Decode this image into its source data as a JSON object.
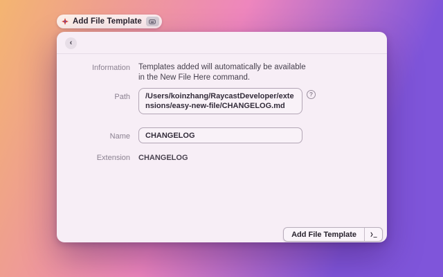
{
  "colors": {
    "bg-start": "#f4b571",
    "bg-mid": "#ee86bd",
    "bg-end": "#7f55da",
    "window-bg": "#f7eef6"
  },
  "toolbar": {
    "title": "Add File Template",
    "extension_icon": "extension-icon",
    "badge_icon": "keycap-icon"
  },
  "window": {
    "back_icon": "‹",
    "form": {
      "information_label": "Information",
      "information_text": "Templates added will automatically be available in the New File Here command.",
      "path_label": "Path",
      "path_value": "/Users/koinzhang/RaycastDeveloper/extensions/easy-new-file/CHANGELOG.md",
      "help_icon": "?",
      "name_label": "Name",
      "name_value": "CHANGELOG",
      "extension_label": "Extension",
      "extension_value": "CHANGELOG"
    },
    "footer": {
      "submit_label": "Add File Template",
      "terminal_icon": "❯_"
    }
  }
}
